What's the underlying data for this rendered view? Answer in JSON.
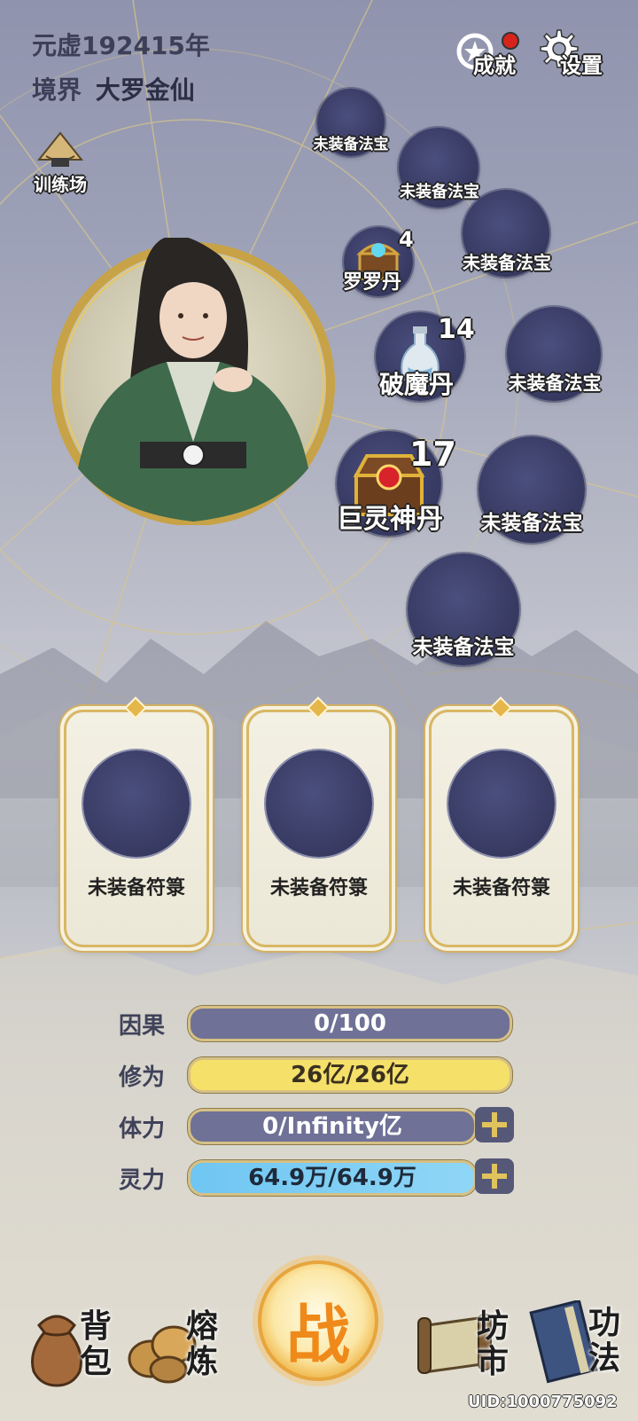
{
  "header": {
    "era": "元虚192415年",
    "realm_label": "境界",
    "realm_value": "大罗金仙",
    "achievement_label": "成就",
    "settings_label": "设置"
  },
  "training": {
    "label": "训练场"
  },
  "equipment_slots": [
    {
      "label": "未装备法宝"
    },
    {
      "label": "未装备法宝"
    },
    {
      "label": "未装备法宝"
    },
    {
      "label": "未装备法宝"
    },
    {
      "label": "未装备法宝"
    },
    {
      "label": "未装备法宝"
    }
  ],
  "pills": [
    {
      "name": "罗罗丹",
      "count": "4"
    },
    {
      "name": "破魔丹",
      "count": "14"
    },
    {
      "name": "巨灵神丹",
      "count": "17"
    }
  ],
  "talismans": [
    {
      "label": "未装备符箓"
    },
    {
      "label": "未装备符箓"
    },
    {
      "label": "未装备符箓"
    }
  ],
  "stats": {
    "karma": {
      "label": "因果",
      "value": "0/100"
    },
    "cultivation": {
      "label": "修为",
      "value": "26亿/26亿"
    },
    "stamina": {
      "label": "体力",
      "value": "0/Infinity亿"
    },
    "spirit": {
      "label": "灵力",
      "value": "64.9万/64.9万"
    }
  },
  "nav": {
    "bag": "背包",
    "smelt": "熔炼",
    "battle": "战",
    "market": "坊市",
    "skills": "功法"
  },
  "uid": "UID:1000775092"
}
